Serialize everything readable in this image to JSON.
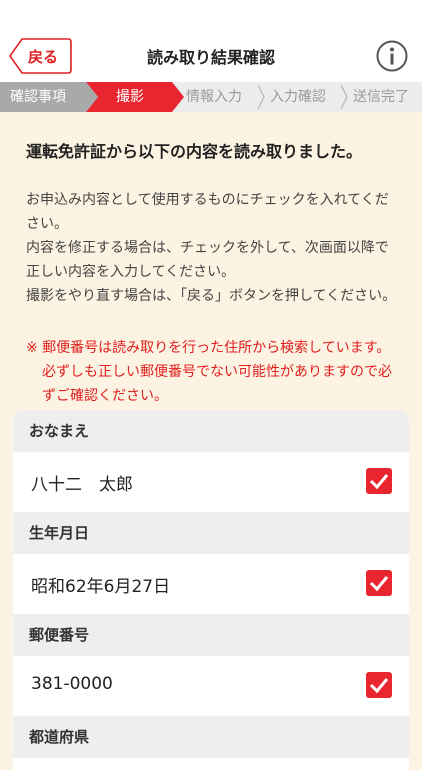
{
  "header": {
    "back_label": "戻る",
    "title": "読み取り結果確認"
  },
  "steps": [
    {
      "label": "確認事項",
      "state": "done"
    },
    {
      "label": "撮影",
      "state": "active"
    },
    {
      "label": "情報入力",
      "state": "upcoming"
    },
    {
      "label": "入力確認",
      "state": "upcoming"
    },
    {
      "label": "送信完了",
      "state": "upcoming"
    }
  ],
  "instructions": {
    "lead": "運転免許証から以下の内容を読み取りました。",
    "para1": "お申込み内容として使用するものにチェックを入れてください。",
    "para2": "内容を修正する場合は、チェックを外して、次画面以降で正しい内容を入力してください。",
    "para3": "撮影をやり直す場合は、「戻る」ボタンを押してください。",
    "notice": "※ 郵便番号は読み取りを行った住所から検索しています。必ずしも正しい郵便番号でない可能性がありますので必ずご確認ください。"
  },
  "fields": [
    {
      "label": "おなまえ",
      "value": "八十二　太郎",
      "checked": true
    },
    {
      "label": "生年月日",
      "value": "昭和62年6月27日",
      "checked": true
    },
    {
      "label": "郵便番号",
      "value": "381-0000",
      "checked": true
    },
    {
      "label": "都道府県"
    }
  ],
  "colors": {
    "accent": "#e02020",
    "check": "#e9262f",
    "background": "#fdf3e2"
  },
  "icons": {
    "info": "info-icon",
    "back": "back-chevron-icon",
    "check": "checkmark-icon"
  }
}
